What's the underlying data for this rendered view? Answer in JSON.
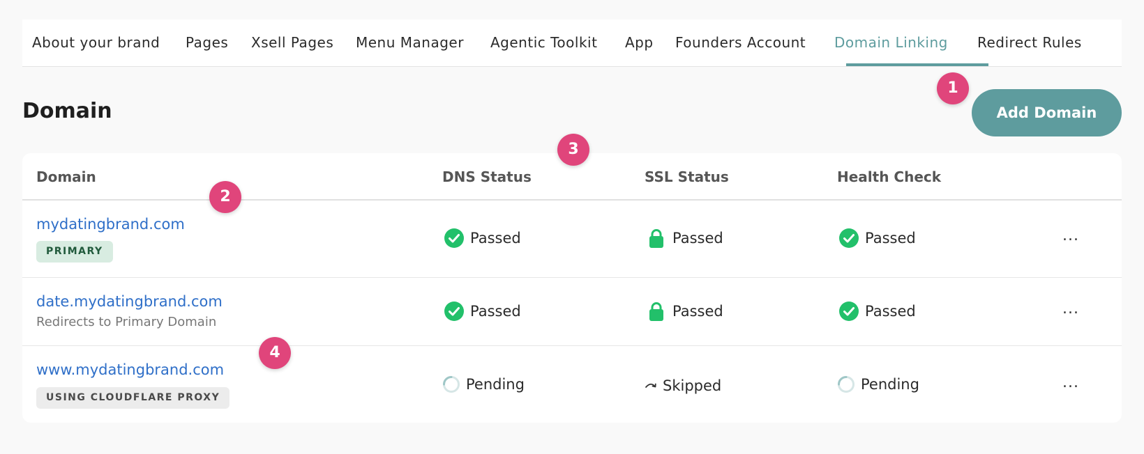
{
  "tabs": [
    {
      "label": "About your brand"
    },
    {
      "label": "Pages"
    },
    {
      "label": "Xsell Pages"
    },
    {
      "label": "Menu Manager"
    },
    {
      "label": "Agentic Toolkit"
    },
    {
      "label": "App"
    },
    {
      "label": "Founders Account"
    },
    {
      "label": "Domain Linking",
      "active": true
    },
    {
      "label": "Redirect Rules"
    }
  ],
  "header": {
    "title": "Domain",
    "add_button": "Add Domain"
  },
  "table": {
    "columns": [
      "Domain",
      "DNS Status",
      "SSL Status",
      "Health Check"
    ],
    "rows": [
      {
        "domain": "mydatingbrand.com",
        "badge": "PRIMARY",
        "dns": "Passed",
        "ssl": "Passed",
        "health": "Passed",
        "more": "..."
      },
      {
        "domain": "date.mydatingbrand.com",
        "note": "Redirects to Primary Domain",
        "dns": "Passed",
        "ssl": "Passed",
        "health": "Passed",
        "more": "..."
      },
      {
        "domain": "www.mydatingbrand.com",
        "badge": "USING CLOUDFLARE PROXY",
        "dns": "Pending",
        "ssl": "Skipped",
        "health": "Pending",
        "more": "..."
      }
    ]
  },
  "markers": [
    "1",
    "2",
    "3",
    "4"
  ],
  "icons": {
    "passed": "check-circle-icon",
    "ssl_passed": "lock-icon",
    "pending": "spinner-icon",
    "skipped": "skip-arrow-icon"
  },
  "colors": {
    "accent": "#5e9c9e",
    "link": "#2f6fc8",
    "success": "#22c06a",
    "marker": "#e0457b",
    "pending": "#9fc7c7"
  }
}
